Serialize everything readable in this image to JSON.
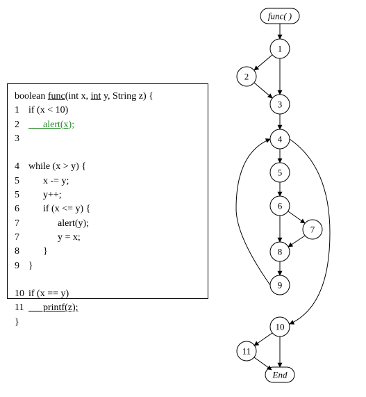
{
  "code": {
    "signature_parts": [
      "boolean ",
      "func",
      "(int x, ",
      "int",
      " y, String z) {"
    ],
    "lines": [
      {
        "n": "1",
        "t": "if (x < 10)"
      },
      {
        "n": "2",
        "t": "      alert(x);",
        "green_underline": true
      },
      {
        "n": "3",
        "t": ""
      },
      {
        "n": "",
        "t": ""
      },
      {
        "n": "4",
        "t": "while (x > y) {"
      },
      {
        "n": "5",
        "t": "      x -= y;"
      },
      {
        "n": "5",
        "t": "      y++;"
      },
      {
        "n": "6",
        "t": "      if (x <= y) {"
      },
      {
        "n": "7",
        "t": "            alert(y);"
      },
      {
        "n": "7",
        "t": "            y = x;"
      },
      {
        "n": "8",
        "t": "      }"
      },
      {
        "n": "9",
        "t": "}"
      },
      {
        "n": "",
        "t": ""
      },
      {
        "n": "10",
        "t": "if (x == y)"
      },
      {
        "n": "11",
        "t": "      printf(z);",
        "underline": true
      },
      {
        "n": "",
        "t": "}",
        "close": true
      }
    ]
  },
  "graph": {
    "func_label": "func( )",
    "end_label": "End",
    "nodes": {
      "1": "1",
      "2": "2",
      "3": "3",
      "4": "4",
      "5": "5",
      "6": "6",
      "7": "7",
      "8": "8",
      "9": "9",
      "10": "10",
      "11": "11"
    }
  }
}
